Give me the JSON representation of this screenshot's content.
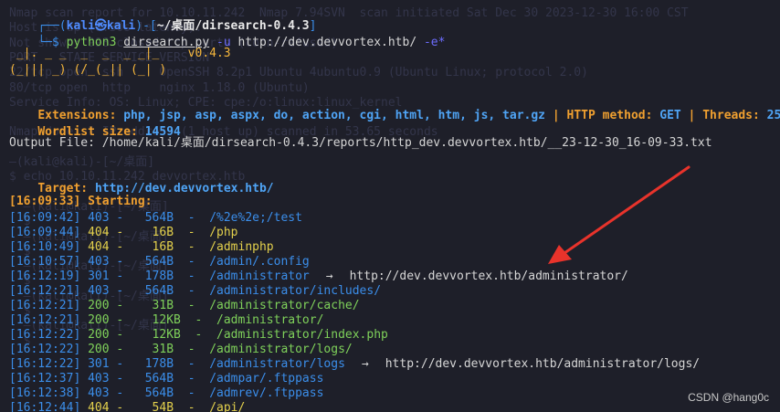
{
  "ghost_lines": [
    "Nmap scan report for 10.10.11.242  Nmap 7.94SVN  scan initiated Sat Dec 30 2023-12-30 16:00 CST",
    "Host is up (0.30s latency).",
    "Not shown: 998 closed tcp ports (conn-refused)",
    "PORT   STATE SERVICE VERSION",
    "22/tcp open  ssh     OpenSSH 8.2p1 Ubuntu 4ubuntu0.9 (Ubuntu Linux; protocol 2.0)",
    "80/tcp open  http    nginx 1.18.0 (Ubuntu)",
    "Service Info: OS: Linux; CPE: cpe:/o:linux:linux_kernel",
    "",
    "Nmap done: 1 IP address (1 host up) scanned in 53.65 seconds",
    "",
    "—(kali@kali)-[~/桌面]",
    "$ echo 10.10.11.242 devvortex.htb",
    "",
    "  —(kali@kali)-[~/桌面]",
    "  $ ",
    "  —(kali@kali)-[~/桌面]",
    "  $ ",
    "  —(kali@kali)-[~/桌面]",
    "  $ ",
    "  —(kali@kali)-[~/桌面]",
    "  $ ",
    "  —(kali@kali)-[~/桌面]",
    "  $ "
  ],
  "prompt": {
    "corner": "┌──(",
    "user": "kali㉿kali",
    "close": ")-[",
    "path": "~/桌面/dirsearch-0.4.3",
    "end": "]",
    "dollar": "└─$ ",
    "cmd": "python3",
    "script": "dirsearch.py",
    "flag_u": "-u",
    "url": "http://dev.devvortex.htb/",
    "flag_e": "-e*"
  },
  "banner": {
    "line1": " _|. _ _  _  _  _ _|_    v0.4.3",
    "line2": "(_||| _) (/_(_|| (_| )"
  },
  "config": {
    "ext_label": "Extensions: ",
    "ext_value": "php, jsp, asp, aspx, do, action, cgi, html, htm, js, tar.gz",
    "sep1": " | ",
    "method_label": "HTTP method: ",
    "method_value": "GET",
    "sep2": " | ",
    "threads_label": "Threads: ",
    "threads_value": "25",
    "wordlist_label": "Wordlist size: ",
    "wordlist_value": "14594"
  },
  "output_file": "Output File: /home/kali/桌面/dirsearch-0.4.3/reports/http_dev.devvortex.htb/__23-12-30_16-09-33.txt",
  "target_label": "Target: ",
  "target_url": "http://dev.devvortex.htb/",
  "starting": "[16:09:33] Starting:",
  "results": [
    {
      "time": "[16:09:42]",
      "code": "403",
      "size": " 564B",
      "path": "/%2e%2e;/test",
      "redirect": ""
    },
    {
      "time": "[16:09:44]",
      "code": "404",
      "size": "  16B",
      "path": "/php",
      "redirect": ""
    },
    {
      "time": "[16:10:49]",
      "code": "404",
      "size": "  16B",
      "path": "/adminphp",
      "redirect": ""
    },
    {
      "time": "[16:10:57]",
      "code": "403",
      "size": " 564B",
      "path": "/admin/.config",
      "redirect": ""
    },
    {
      "time": "[16:12:19]",
      "code": "301",
      "size": " 178B",
      "path": "/administrator",
      "redirect": "http://dev.devvortex.htb/administrator/"
    },
    {
      "time": "[16:12:21]",
      "code": "403",
      "size": " 564B",
      "path": "/administrator/includes/",
      "redirect": ""
    },
    {
      "time": "[16:12:21]",
      "code": "200",
      "size": "  31B",
      "path": "/administrator/cache/",
      "redirect": ""
    },
    {
      "time": "[16:12:21]",
      "code": "200",
      "size": "  12KB",
      "path": "/administrator/",
      "redirect": ""
    },
    {
      "time": "[16:12:22]",
      "code": "200",
      "size": "  12KB",
      "path": "/administrator/index.php",
      "redirect": ""
    },
    {
      "time": "[16:12:22]",
      "code": "200",
      "size": "  31B",
      "path": "/administrator/logs/",
      "redirect": ""
    },
    {
      "time": "[16:12:22]",
      "code": "301",
      "size": " 178B",
      "path": "/administrator/logs",
      "redirect": "http://dev.devvortex.htb/administrator/logs/"
    },
    {
      "time": "[16:12:37]",
      "code": "403",
      "size": " 564B",
      "path": "/admpar/.ftppass",
      "redirect": ""
    },
    {
      "time": "[16:12:38]",
      "code": "403",
      "size": " 564B",
      "path": "/admrev/.ftppass",
      "redirect": ""
    },
    {
      "time": "[16:12:44]",
      "code": "404",
      "size": "  54B",
      "path": "/api/",
      "redirect": ""
    }
  ],
  "arrow_symbol": "→",
  "watermark": "CSDN @hang0c",
  "colors": {
    "background": "#1e1f29",
    "annotation_arrow": "#e8332b",
    "code_200": "#7fd15a",
    "code_301": "#3b8eea",
    "code_403": "#3b8eea",
    "code_404": "#e3d04c"
  }
}
